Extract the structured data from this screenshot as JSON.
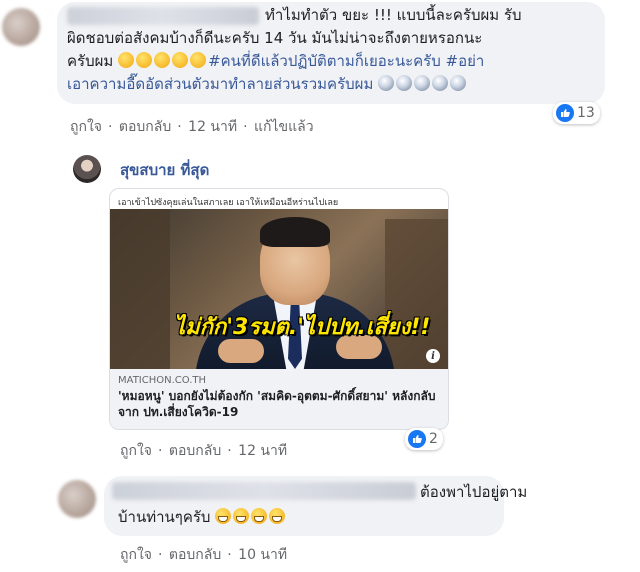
{
  "comments": [
    {
      "lines": [
        {
          "text": "ทำไมทำตัว ขยะ !!! แบบนี้ละครับผม รับ"
        },
        {
          "text": "ผิดชอบต่อสังคมบ้างก็ดีนะครับ 14 วัน มันไม่น่าจะถึงตายหรอกนะ"
        },
        {
          "text": "ครับผม",
          "emoji_count": 5,
          "emoji": "tired-face",
          "tag": "#คนที่ดีแล้วปฏิบัติตามก็เยอะนะครับ #อย่า"
        },
        {
          "tag": "เอาความอี๊ดอัดส่วนตัวมาทำลายส่วนรวมครับผม",
          "emoji_count": 5,
          "emoji": "screaming-face"
        }
      ],
      "actions": {
        "like": "ถูกใจ",
        "reply": "ตอบกลับ",
        "time": "12 นาที",
        "edited": "แก้ไขแล้ว"
      },
      "reaction_count": "13"
    },
    {
      "author": "สุขสบาย ที่สุด",
      "card": {
        "caption": "เอาเข้าไปซังคุยเล่นในสภาเลย เอาให้เหมือนอีหร่านไปเลย",
        "headline": "ไม่กัก'3รมต.'ไปปท.เสี่ยง!!",
        "domain": "MATICHON.CO.TH",
        "title": "'หมอหนู' บอกยังไม่ต้องกัก 'สมคิด-อุตตม-ศักดิ์สยาม' หลังกลับจาก ปท.เสี่ยงโควิด-19"
      },
      "actions": {
        "like": "ถูกใจ",
        "reply": "ตอบกลับ",
        "time": "12 นาที"
      },
      "reaction_count": "2"
    },
    {
      "lines": [
        {
          "text": "ต้องพาไปอยู่ตาม"
        },
        {
          "text": "บ้านท่านๆครับ",
          "emoji_count": 4,
          "emoji": "grinning-face"
        }
      ],
      "actions": {
        "like": "ถูกใจ",
        "reply": "ตอบกลับ",
        "time": "10 นาที"
      }
    }
  ],
  "colors": {
    "link": "#385898",
    "bubble": "#f0f2f5",
    "muted": "#65676b",
    "like_blue": "#1877f2"
  }
}
